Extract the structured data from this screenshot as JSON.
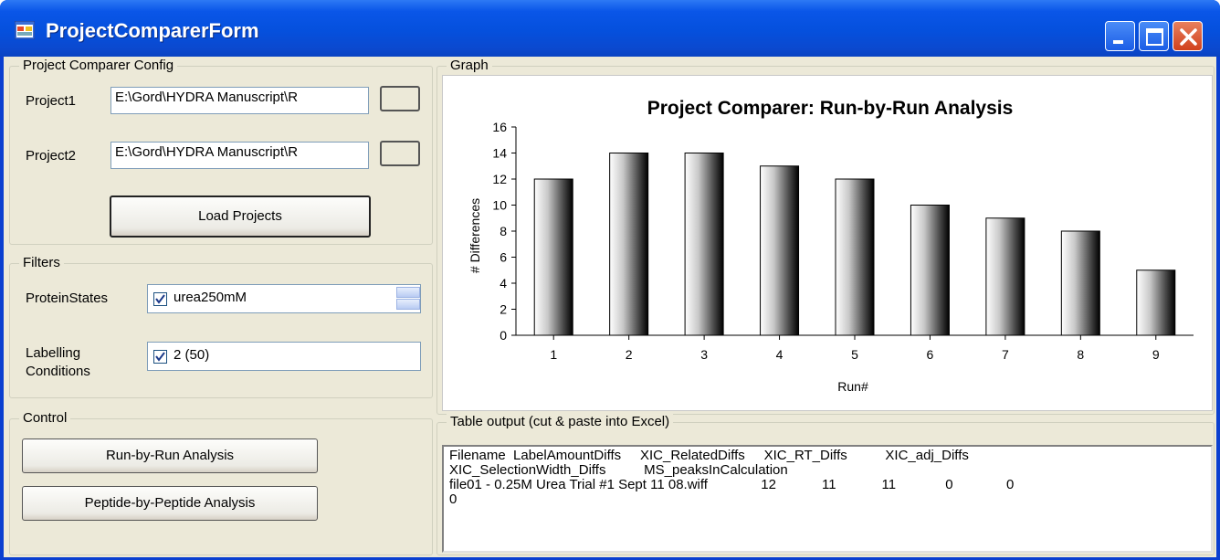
{
  "window": {
    "title": "ProjectComparerForm"
  },
  "config": {
    "legend": "Project Comparer Config",
    "project1_label": "Project1",
    "project1_value": "E:\\Gord\\HYDRA Manuscript\\R",
    "project2_label": "Project2",
    "project2_value": "E:\\Gord\\HYDRA Manuscript\\R",
    "load_button": "Load Projects"
  },
  "filters": {
    "legend": "Filters",
    "protein_states_label": "ProteinStates",
    "protein_states_value": "urea250mM",
    "labelling_label_line1": "Labelling",
    "labelling_label_line2": "Conditions",
    "labelling_value": "2 (50)"
  },
  "control": {
    "legend": "Control",
    "run_button": "Run-by-Run Analysis",
    "peptide_button": "Peptide-by-Peptide Analysis"
  },
  "graph": {
    "legend": "Graph"
  },
  "table_output": {
    "legend": "Table output (cut & paste into Excel)",
    "text": "Filename  LabelAmountDiffs     XIC_RelatedDiffs     XIC_RT_Diffs          XIC_adj_Diffs\nXIC_SelectionWidth_Diffs          MS_peaksInCalculation\nfile01 - 0.25M Urea Trial #1 Sept 11 08.wiff              12            11            11             0              0\n0"
  },
  "chart_data": {
    "type": "bar",
    "title": "Project Comparer: Run-by-Run Analysis",
    "xlabel": "Run#",
    "ylabel": "# Differences",
    "categories": [
      "1",
      "2",
      "3",
      "4",
      "5",
      "6",
      "7",
      "8",
      "9"
    ],
    "values": [
      12,
      14,
      14,
      13,
      12,
      10,
      9,
      8,
      5
    ],
    "ylim": [
      0,
      16
    ],
    "yticks": [
      0,
      2,
      4,
      6,
      8,
      10,
      12,
      14,
      16
    ],
    "grid": false,
    "legend": "none"
  }
}
